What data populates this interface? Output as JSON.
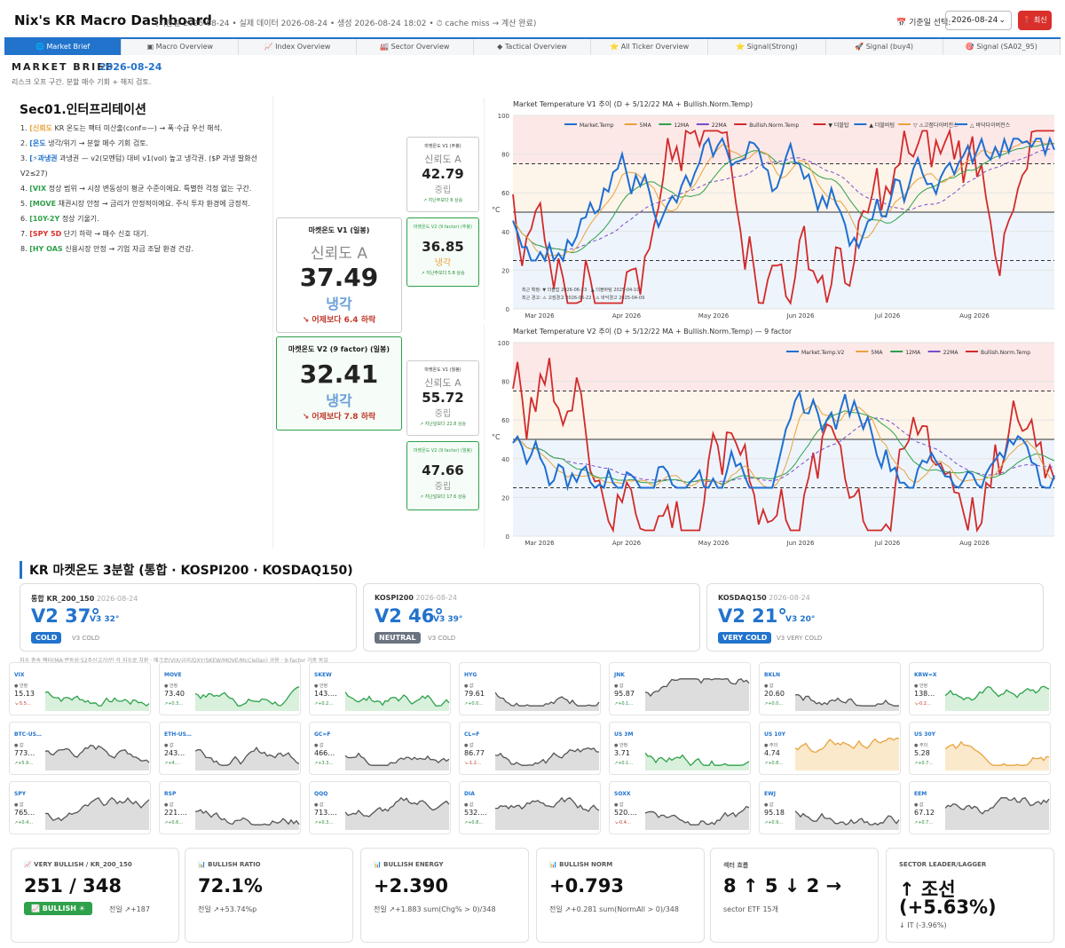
{
  "header": {
    "title": "Nix's KR Macro Dashboard",
    "meta": "(기준일 2026-08-24 • 실제 데이터 2026-08-24 • 생성 2026-08-24 18:02 • ⏱ cache miss → 계산 완료)",
    "date_label": "📅 기준일 선택:",
    "date_value": "2026-08-24",
    "refresh_label": "📍 최신"
  },
  "tabs": [
    "🌐 Market Brief",
    "▣ Macro Overview",
    "📈 Index Overview",
    "🏭 Sector Overview",
    "◆ Tactical Overview",
    "⭐ All Ticker Overview",
    "⭐ Signal(Strong)",
    "🚀 Signal (buy4)",
    "🎯 Signal (SA02_95)"
  ],
  "brief": {
    "title": "MARKET BRIEF",
    "date": "2026-08-24",
    "subtitle": "리스크 오프 구간. 분할 매수 기회 + 헤지 검토."
  },
  "sec01": {
    "title": "Sec01.인터프리테이션",
    "items": [
      {
        "n": "1.",
        "tag": "[신뢰도",
        "tag_color": "#e8a33c",
        "text": " KR 온도는 팩터 미산출(conf=—) → 폭·수급 우선 해석."
      },
      {
        "n": "2.",
        "tag": "[온도",
        "tag_color": "#2273cc",
        "text": " 냉각/위기 → 분할 매수 기회 검토."
      },
      {
        "n": "3.",
        "tag": "[⚡과냉권",
        "tag_color": "#2273cc",
        "text": " 과냉권 — v2(모멘텀) 대비 v1(vol) 높고 냉각권. ($P 과냉 발화선 V2≤27)"
      },
      {
        "n": "4.",
        "tag": "[VIX",
        "tag_color": "#2ea14a",
        "text": " 정상 범위 → 시장 변동성이 평균 수준이에요. 특별한 걱정 없는 구간."
      },
      {
        "n": "5.",
        "tag": "[MOVE",
        "tag_color": "#2ea14a",
        "text": " 채권시장 안정 → 금리가 안정적이에요. 주식 투자 환경에 긍정적."
      },
      {
        "n": "6.",
        "tag": "[10Y-2Y",
        "tag_color": "#2ea14a",
        "text": " 정상 기울기."
      },
      {
        "n": "7.",
        "tag": "[SPY 5D",
        "tag_color": "#d9302c",
        "text": " 단기 하락 → 매수 신호 대기."
      },
      {
        "n": "8.",
        "tag": "[HY OAS",
        "tag_color": "#2ea14a",
        "text": " 신용시장 안정 → 기업 자금 조달 환경 건강."
      }
    ]
  },
  "gauges": {
    "v1": {
      "title": "마켓온도 V1 (일봉)",
      "rel": "신뢰도 A",
      "value": "37.49",
      "state": "냉각",
      "delta": "↘ 어제보다 6.4 하락"
    },
    "v2": {
      "title": "마켓온도 V2 (9 factor) (일봉)",
      "value": "32.41",
      "state": "냉각",
      "delta": "↘ 어제보다 7.8 하락"
    },
    "w1": {
      "title": "마켓온도 V1 (주봉)",
      "rel": "신뢰도 A",
      "value": "42.79",
      "state": "중립",
      "delta": "↗ 지난주보다 8 상승"
    },
    "w2": {
      "title": "마켓온도 V2 (9 factor) (주봉)",
      "value": "36.85",
      "state": "냉각",
      "delta": "↗ 지난주보다 5.8 상승"
    },
    "m1": {
      "title": "마켓온도 V1 (월봉)",
      "rel": "신뢰도 A",
      "value": "55.72",
      "state": "중립",
      "delta": "↗ 지난달보다 22.8 상승"
    },
    "m2": {
      "title": "마켓온도 V2 (9 factor) (월봉)",
      "value": "47.66",
      "state": "중립",
      "delta": "↗ 지난달보다 17.6 상승"
    }
  },
  "charts": {
    "c1": {
      "title": "Market Temperature V1 추이 (D + 5/12/22 MA + Bullish.Norm.Temp)",
      "legend": [
        "Market.Temp",
        "5MA",
        "12MA",
        "22MA",
        "Bullish.Norm.Temp",
        "▼ 더블탑",
        "▲ 더블바텀",
        "▽ ⚠고점다이버전스",
        "△ 바닥다이버전스"
      ],
      "note1": "최근 확정: ▼ 더블탑 2026-06-23 · ▲ 더블바텀 2025-04-10",
      "note2": "최근 경고: ⚠ 고점경고 2026-06-22 · ⚠ 바닥경고 2025-04-09",
      "ylabel": "°C",
      "yticks": [
        "100",
        "80",
        "60",
        "40",
        "20",
        "0"
      ],
      "xticks": [
        "Mar 2026",
        "Apr 2026",
        "May 2026",
        "Jun 2026",
        "Jul 2026",
        "Aug 2026"
      ]
    },
    "c2": {
      "title": "Market Temperature V2 추이 (D + 5/12/22 MA + Bullish.Norm.Temp) — 9 factor",
      "legend": [
        "Market.Temp.V2",
        "5MA",
        "12MA",
        "22MA",
        "Bullish.Norm.Temp"
      ],
      "ylabel": "°C",
      "yticks": [
        "100",
        "80",
        "60",
        "40",
        "20",
        "0"
      ],
      "xticks": [
        "Mar 2026",
        "Apr 2026",
        "May 2026",
        "Jun 2026",
        "Jul 2026",
        "Aug 2026"
      ]
    }
  },
  "kr3": {
    "title": "KR 마켓온도 3분할 (통합 · KOSPI200 · KOSDAQ150)",
    "cards": [
      {
        "name": "통합 KR_200_150",
        "date": "2026-08-24",
        "v2": "V2 37°",
        "v3": "V3 32°",
        "badge": "COLD",
        "badge_color": "#2273cc",
        "v3label": "V3 COLD"
      },
      {
        "name": "KOSPI200",
        "date": "2026-08-24",
        "v2": "V2 46°",
        "v3": "V3 39°",
        "badge": "NEUTRAL",
        "badge_color": "#6b7280",
        "v3label": "V3 COLD"
      },
      {
        "name": "KOSDAQ150",
        "date": "2026-08-24",
        "v2": "V2 21°",
        "v3": "V3 20°",
        "badge": "VERY COLD",
        "badge_color": "#2273cc",
        "v3label": "V3 VERY COLD"
      }
    ],
    "note": "지수 충속 팩터(MA·변동성·52주신고가)만 각 지수로 치환 · 매크로(VIX/금리/DXY/SKEW/MOVE/McClellan) 공용 · 9-factor 가중 동일"
  },
  "tickers": [
    {
      "name": "VIX",
      "status": "● 안정",
      "value": "15.13",
      "chg": "↘-5.5…",
      "kind": "green"
    },
    {
      "name": "MOVE",
      "status": "● 안정",
      "value": "73.40",
      "chg": "↗+0.3…",
      "kind": "green"
    },
    {
      "name": "SKEW",
      "status": "● 안정",
      "value": "143.…",
      "chg": "↗+0.2…",
      "kind": "green"
    },
    {
      "name": "HYG",
      "status": "● 값",
      "value": "79.61",
      "chg": "↗+0.0…",
      "kind": "gray"
    },
    {
      "name": "JNK",
      "status": "● 값",
      "value": "95.87",
      "chg": "↗+0.1…",
      "kind": "gray"
    },
    {
      "name": "BKLN",
      "status": "● 값",
      "value": "20.60",
      "chg": "↗+0.0…",
      "kind": "gray"
    },
    {
      "name": "KRW=X",
      "status": "● 안정",
      "value": "138…",
      "chg": "↘-0.2…",
      "kind": "green"
    },
    {
      "name": "BTC-US…",
      "status": "● 값",
      "value": "773…",
      "chg": "↗+5.9…",
      "kind": "gray"
    },
    {
      "name": "ETH-US…",
      "status": "● 값",
      "value": "243…",
      "chg": "↗+4.…",
      "kind": "gray"
    },
    {
      "name": "GC=F",
      "status": "● 값",
      "value": "466…",
      "chg": "↗+3.3…",
      "kind": "gray"
    },
    {
      "name": "CL=F",
      "status": "● 값",
      "value": "86.77",
      "chg": "↘-1.2…",
      "kind": "gray"
    },
    {
      "name": "US 3M",
      "status": "● 안정",
      "value": "3.71",
      "chg": "↗+0.1…",
      "kind": "green"
    },
    {
      "name": "US 10Y",
      "status": "● 주의",
      "value": "4.74",
      "chg": "↗+0.8…",
      "kind": "orange"
    },
    {
      "name": "US 30Y",
      "status": "● 주의",
      "value": "5.28",
      "chg": "↗+0.7…",
      "kind": "orange"
    },
    {
      "name": "SPY",
      "status": "● 값",
      "value": "765…",
      "chg": "↗+0.4…",
      "kind": "gray"
    },
    {
      "name": "RSP",
      "status": "● 값",
      "value": "221.…",
      "chg": "↗+0.6…",
      "kind": "gray"
    },
    {
      "name": "QQQ",
      "status": "● 값",
      "value": "713.…",
      "chg": "↗+0.3…",
      "kind": "gray"
    },
    {
      "name": "DIA",
      "status": "● 값",
      "value": "532.…",
      "chg": "↗+0.8…",
      "kind": "gray"
    },
    {
      "name": "SOXX",
      "status": "● 값",
      "value": "520.…",
      "chg": "↘-0.4…",
      "kind": "gray"
    },
    {
      "name": "EWJ",
      "status": "● 값",
      "value": "95.18",
      "chg": "↗+0.9…",
      "kind": "gray"
    },
    {
      "name": "EEM",
      "status": "● 값",
      "value": "67.12",
      "chg": "↗+0.7…",
      "kind": "gray"
    }
  ],
  "stats": [
    {
      "title": "📈 VERY BULLISH / KR_200_150",
      "value": "251 / 348",
      "sub": "전일 ↗+187",
      "badge": "📈 BULLISH ☀"
    },
    {
      "title": "📊 BULLISH RATIO",
      "value": "72.1%",
      "sub": "전일 ↗+53.74%p"
    },
    {
      "title": "📊 BULLISH ENERGY",
      "value": "+2.390",
      "sub": "전일 ↗+1.883 sum(Chg% > 0)/348"
    },
    {
      "title": "📊 BULLISH NORM",
      "value": "+0.793",
      "sub": "전일 ↗+0.281 sum(NormAll > 0)/348"
    },
    {
      "title": "섹터 흐름",
      "value": "8 ↑ 5 ↓ 2 →",
      "sub": "sector ETF 15개"
    },
    {
      "title": "SECTOR LEADER/LAGGER",
      "value": "↑ 조선",
      "value2": "(+5.63%)",
      "sub": "↓ IT (-3.96%)"
    }
  ]
}
